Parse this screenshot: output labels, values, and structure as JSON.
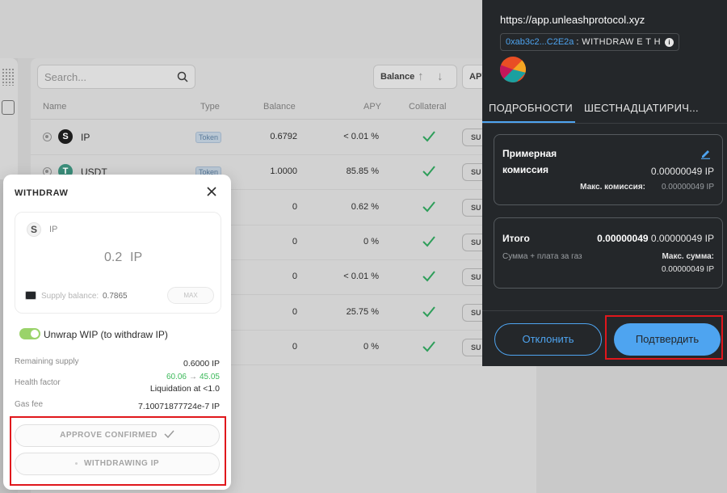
{
  "app": {
    "search_placeholder": "Search...",
    "sort_label": "Balance",
    "sort_up_icon": "arrow-up-icon",
    "sort_down_icon": "arrow-down-icon",
    "apy_filter_label": "APY",
    "table": {
      "headers": [
        "Name",
        "Type",
        "Balance",
        "APY",
        "Collateral"
      ],
      "rows": [
        {
          "logo": "S",
          "name": "IP",
          "type": "Token",
          "balance": "0.6792",
          "apy": "< 0.01 %",
          "collateral": true,
          "action": "SU"
        },
        {
          "logo": "T",
          "name": "USDT",
          "type": "Token",
          "balance": "1.0000",
          "apy": "85.85 %",
          "collateral": true,
          "action": "SU"
        },
        {
          "logo": "",
          "name": "",
          "type": "",
          "balance": "0",
          "apy": "0.62 %",
          "collateral": true,
          "action": "SU"
        },
        {
          "logo": "",
          "name": "",
          "type": "",
          "balance": "0",
          "apy": "0 %",
          "collateral": true,
          "action": "SU"
        },
        {
          "logo": "",
          "name": "",
          "type": "",
          "balance": "0",
          "apy": "< 0.01 %",
          "collateral": true,
          "action": "SU"
        },
        {
          "logo": "",
          "name": "",
          "type": "",
          "balance": "0",
          "apy": "25.75 %",
          "collateral": true,
          "action": "SU"
        },
        {
          "logo": "",
          "name": "",
          "type": "",
          "balance": "0",
          "apy": "0 %",
          "collateral": true,
          "action": "SU"
        }
      ]
    }
  },
  "withdraw_modal": {
    "title": "WITHDRAW",
    "asset_logo": "S",
    "asset_name": "IP",
    "amount": "0.2",
    "amount_unit": "IP",
    "supply_balance_label": "Supply balance:",
    "supply_balance_value": "0.7865",
    "max_label": "MAX",
    "unwrap_label": "Unwrap WIP (to withdraw IP)",
    "unwrap_enabled": true,
    "remaining_supply_label": "Remaining supply",
    "remaining_supply_value": "0.6000 IP",
    "health_factor_label": "Health factor",
    "health_factor_from": "60.06",
    "health_factor_arrow": "→",
    "health_factor_to": "45.05",
    "liquidation_text": "Liquidation at <1.0",
    "gas_fee_label": "Gas fee",
    "gas_fee_value": "7.10071877724e-7 IP",
    "approve_button": "APPROVE CONFIRMED",
    "withdraw_button": "WITHDRAWING IP",
    "highlight_color": "#e0171c"
  },
  "wallet_popup": {
    "url": "https://app.unleashprotocol.xyz",
    "address_short": "0xab3c2...C2E2a",
    "method": ": WITHDRAW E T H",
    "info_glyph": "i",
    "tabs": [
      "ПОДРОБНОСТИ",
      "ШЕСТНАДЦАТИРИЧ..."
    ],
    "fee_card": {
      "label_line1": "Примерная",
      "label_line2": "комиссия",
      "value": "0.00000049 IP",
      "max_label": "Макс. комиссия:",
      "max_value": "0.00000049 IP"
    },
    "total_card": {
      "label": "Итого",
      "value_bold": "0.00000049",
      "value": "0.00000049 IP",
      "sub_label": "Сумма + плата за газ",
      "max_label": "Макс. сумма:",
      "max_value": "0.00000049 IP"
    },
    "reject_button": "Отклонить",
    "confirm_button": "Подтвердить",
    "accent_color": "#4ea4f0"
  }
}
